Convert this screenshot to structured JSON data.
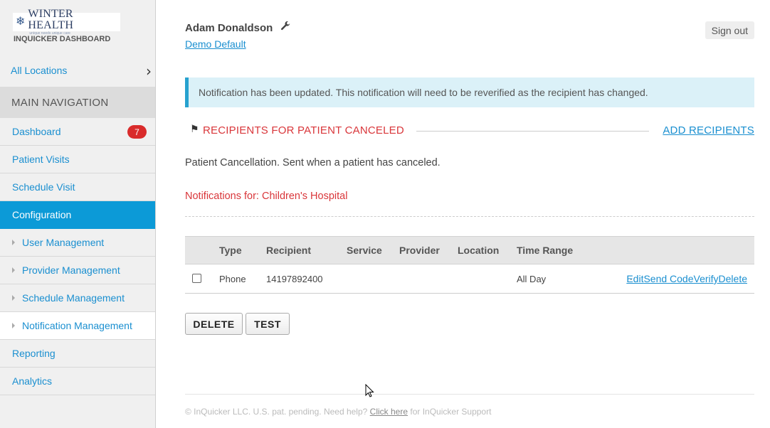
{
  "brand": {
    "logo_name": "WINTER HEALTH",
    "logo_tagline": "unique needs unique care",
    "dashboard_label": "INQUICKER DASHBOARD"
  },
  "sidebar": {
    "all_locations": "All Locations",
    "main_nav_heading": "MAIN NAVIGATION",
    "items": [
      {
        "label": "Dashboard",
        "badge": "7"
      },
      {
        "label": "Patient Visits"
      },
      {
        "label": "Schedule Visit"
      },
      {
        "label": "Configuration",
        "active": true
      },
      {
        "label": "User Management",
        "sub": true
      },
      {
        "label": "Provider Management",
        "sub": true
      },
      {
        "label": "Schedule Management",
        "sub": true
      },
      {
        "label": "Notification Management",
        "sub": true,
        "selected": true
      },
      {
        "label": "Reporting"
      },
      {
        "label": "Analytics"
      }
    ],
    "active_color": "#0c9ad7",
    "badge_color": "#d92b2b"
  },
  "header": {
    "user_name": "Adam Donaldson",
    "org_link": "Demo Default",
    "sign_out": "Sign out"
  },
  "alert": {
    "message": "Notification has been updated. This notification will need to be reverified as the recipient has changed."
  },
  "section": {
    "title": "RECIPIENTS FOR PATIENT CANCELED",
    "add_link": "ADD RECIPIENTS",
    "description": "Patient Cancellation. Sent when a patient has canceled.",
    "notifications_for": "Notifications for: Children's Hospital"
  },
  "table": {
    "headers": [
      "Type",
      "Recipient",
      "Service",
      "Provider",
      "Location",
      "Time Range"
    ],
    "rows": [
      {
        "type": "Phone",
        "recipient": "14197892400",
        "service": "",
        "provider": "",
        "location": "",
        "time_range": "All Day",
        "actions": [
          "Edit",
          "Send Code",
          "Verify",
          "Delete"
        ]
      }
    ]
  },
  "buttons": {
    "delete": "DELETE",
    "test": "TEST"
  },
  "footer": {
    "prefix": "© InQuicker LLC. U.S. pat. pending. Need help?",
    "link": "Click here",
    "suffix": "for InQuicker Support"
  }
}
